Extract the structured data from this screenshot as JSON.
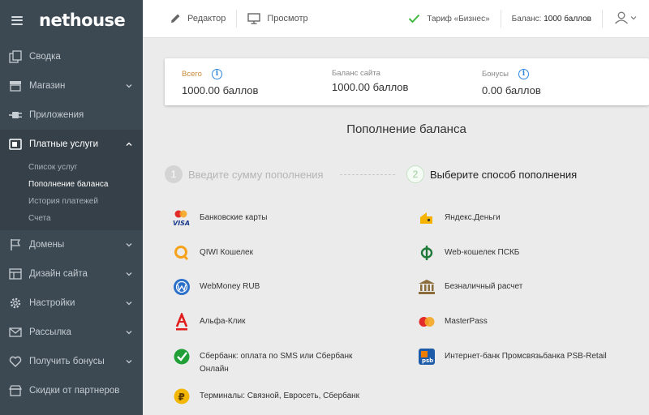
{
  "sidebar": {
    "logo": "nethouse",
    "items": [
      {
        "label": "Сводка",
        "icon": "copy-icon"
      },
      {
        "label": "Магазин",
        "icon": "shop-icon"
      },
      {
        "label": "Приложения",
        "icon": "plug-icon"
      },
      {
        "label": "Платные услуги",
        "icon": "wallet-icon"
      },
      {
        "label": "Домены",
        "icon": "flag-icon"
      },
      {
        "label": "Дизайн сайта",
        "icon": "layout-icon"
      },
      {
        "label": "Настройки",
        "icon": "gear-icon"
      },
      {
        "label": "Рассылка",
        "icon": "mail-icon"
      },
      {
        "label": "Получить бонусы",
        "icon": "heart-icon"
      },
      {
        "label": "Скидки от партнеров",
        "icon": "store-icon"
      }
    ],
    "submenu": [
      "Список услуг",
      "Пополнение баланса",
      "История платежей",
      "Счета"
    ]
  },
  "topbar": {
    "editor": "Редактор",
    "preview": "Просмотр",
    "tariff": "Тариф «Бизнес»",
    "balance_label": "Баланс:",
    "balance_value": "1000 баллов"
  },
  "card": {
    "total_caption": "Всего",
    "total_value": "1000.00 баллов",
    "site_caption": "Баланс сайта",
    "site_value": "1000.00 баллов",
    "bonus_caption": "Бонусы",
    "bonus_value": "0.00 баллов"
  },
  "main": {
    "title": "Пополнение баланса",
    "step1_num": "1",
    "step1_label": "Введите сумму пополнения",
    "step2_num": "2",
    "step2_label": "Выберите способ пополнения"
  },
  "payments": {
    "left": [
      "Банковские карты",
      "QIWI Кошелек",
      "WebMoney RUB",
      "Альфа-Клик",
      "Сбербанк: оплата по SMS или Сбербанк Онлайн",
      "Терминалы: Связной, Евросеть, Сбербанк"
    ],
    "right": [
      "Яндекс.Деньги",
      "Web-кошелек ПСКБ",
      "Безналичный расчет",
      "MasterPass",
      "Интернет-банк Промсвязьбанка PSB-Retail"
    ]
  },
  "colors": {
    "sidebar": "#3c4852",
    "accent_green": "#3db83d",
    "info_blue": "#2e86de"
  }
}
